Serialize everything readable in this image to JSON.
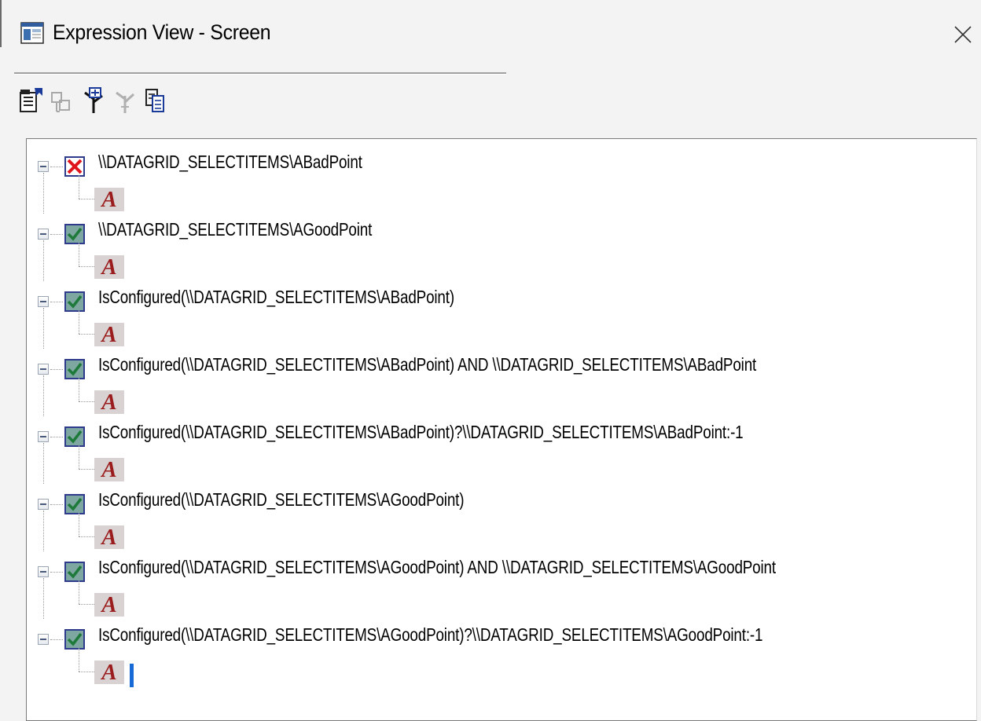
{
  "window": {
    "title": "Expression View - Screen",
    "icons": {
      "app": "app-window-icon",
      "close": "close-icon"
    }
  },
  "toolbar": {
    "buttons": [
      {
        "name": "properties-button",
        "icon": "properties-icon",
        "enabled": true
      },
      {
        "name": "collapse-button",
        "icon": "collapse-tree-icon",
        "enabled": false
      },
      {
        "name": "expand-tree-button",
        "icon": "expand-tree-icon",
        "enabled": true
      },
      {
        "name": "tree-disabled-button",
        "icon": "tree-icon",
        "enabled": false
      },
      {
        "name": "copy-button",
        "icon": "copy-icon",
        "enabled": true
      }
    ]
  },
  "tree": {
    "nodes": [
      {
        "label": "\\\\DATAGRID_SELECTITEMS\\ABadPoint",
        "status": "invalid",
        "child_icon_letter": "A"
      },
      {
        "label": "\\\\DATAGRID_SELECTITEMS\\AGoodPoint",
        "status": "valid",
        "child_icon_letter": "A"
      },
      {
        "label": "IsConfigured(\\\\DATAGRID_SELECTITEMS\\ABadPoint)",
        "status": "valid",
        "child_icon_letter": "A"
      },
      {
        "label": "IsConfigured(\\\\DATAGRID_SELECTITEMS\\ABadPoint) AND \\\\DATAGRID_SELECTITEMS\\ABadPoint",
        "status": "valid",
        "child_icon_letter": "A"
      },
      {
        "label": "IsConfigured(\\\\DATAGRID_SELECTITEMS\\ABadPoint)?\\\\DATAGRID_SELECTITEMS\\ABadPoint:-1",
        "status": "valid",
        "child_icon_letter": "A"
      },
      {
        "label": "IsConfigured(\\\\DATAGRID_SELECTITEMS\\AGoodPoint)",
        "status": "valid",
        "child_icon_letter": "A"
      },
      {
        "label": "IsConfigured(\\\\DATAGRID_SELECTITEMS\\AGoodPoint) AND \\\\DATAGRID_SELECTITEMS\\AGoodPoint",
        "status": "valid",
        "child_icon_letter": "A"
      },
      {
        "label": "IsConfigured(\\\\DATAGRID_SELECTITEMS\\AGoodPoint)?\\\\DATAGRID_SELECTITEMS\\AGoodPoint:-1",
        "status": "valid",
        "child_icon_letter": "A"
      }
    ]
  },
  "colors": {
    "valid_check": "#1d7a3a",
    "invalid_x": "#e0141c",
    "icon_letter": "#9b1c1c",
    "cursor": "#1769d6"
  }
}
